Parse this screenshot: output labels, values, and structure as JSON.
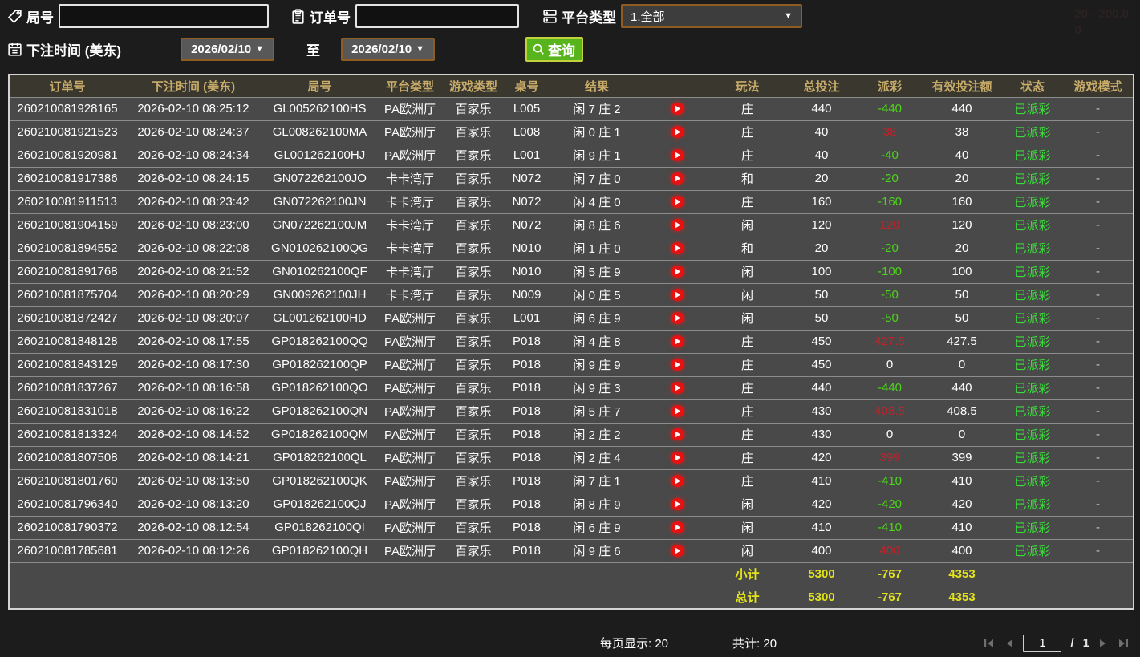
{
  "colors": {
    "header_text": "#c9ac6a",
    "row_bg": "#494949",
    "payout_negative": "#4cd41a",
    "payout_positive": "#bd242c",
    "status_green": "#3bdc3b",
    "totals_yellow": "#e3e31c",
    "search_button_green": "#58b41c",
    "date_border_brown": "#8f5c21",
    "play_button_red": "#e61212"
  },
  "filters": {
    "round_label": "局号",
    "round_value": "",
    "order_label": "订单号",
    "order_value": "",
    "platform_label": "平台类型",
    "platform_value": "1.全部",
    "bet_time_label": "下注时间 (美东)",
    "date_from": "2026/02/10",
    "to_label": "至",
    "date_to": "2026/02/10",
    "search_label": "查询"
  },
  "ghost": {
    "line1": "20 - 200.0",
    "line2": "0"
  },
  "table": {
    "columns": [
      "订单号",
      "下注时间 (美东)",
      "局号",
      "平台类型",
      "游戏类型",
      "桌号",
      "结果",
      "",
      "玩法",
      "总投注",
      "派彩",
      "有效投注额",
      "状态",
      "游戏模式"
    ],
    "rows": [
      {
        "order": "260210081928165",
        "time": "2026-02-10 08:25:12",
        "round": "GL005262100HS",
        "platform": "PA欧洲厅",
        "game": "百家乐",
        "table_no": "L005",
        "result": "闲 7 庄 2",
        "playtype": "庄",
        "bet": "440",
        "payout": "-440",
        "payout_class": "pay-neg",
        "valid": "440",
        "status": "已派彩",
        "mode": "-"
      },
      {
        "order": "260210081921523",
        "time": "2026-02-10 08:24:37",
        "round": "GL008262100MA",
        "platform": "PA欧洲厅",
        "game": "百家乐",
        "table_no": "L008",
        "result": "闲 0 庄 1",
        "playtype": "庄",
        "bet": "40",
        "payout": "38",
        "payout_class": "pay-pos",
        "valid": "38",
        "status": "已派彩",
        "mode": "-"
      },
      {
        "order": "260210081920981",
        "time": "2026-02-10 08:24:34",
        "round": "GL001262100HJ",
        "platform": "PA欧洲厅",
        "game": "百家乐",
        "table_no": "L001",
        "result": "闲 9 庄 1",
        "playtype": "庄",
        "bet": "40",
        "payout": "-40",
        "payout_class": "pay-neg",
        "valid": "40",
        "status": "已派彩",
        "mode": "-"
      },
      {
        "order": "260210081917386",
        "time": "2026-02-10 08:24:15",
        "round": "GN072262100JO",
        "platform": "卡卡湾厅",
        "game": "百家乐",
        "table_no": "N072",
        "result": "闲 7 庄 0",
        "playtype": "和",
        "bet": "20",
        "payout": "-20",
        "payout_class": "pay-neg",
        "valid": "20",
        "status": "已派彩",
        "mode": "-"
      },
      {
        "order": "260210081911513",
        "time": "2026-02-10 08:23:42",
        "round": "GN072262100JN",
        "platform": "卡卡湾厅",
        "game": "百家乐",
        "table_no": "N072",
        "result": "闲 4 庄 0",
        "playtype": "庄",
        "bet": "160",
        "payout": "-160",
        "payout_class": "pay-neg",
        "valid": "160",
        "status": "已派彩",
        "mode": "-"
      },
      {
        "order": "260210081904159",
        "time": "2026-02-10 08:23:00",
        "round": "GN072262100JM",
        "platform": "卡卡湾厅",
        "game": "百家乐",
        "table_no": "N072",
        "result": "闲 8 庄 6",
        "playtype": "闲",
        "bet": "120",
        "payout": "120",
        "payout_class": "pay-pos",
        "valid": "120",
        "status": "已派彩",
        "mode": "-"
      },
      {
        "order": "260210081894552",
        "time": "2026-02-10 08:22:08",
        "round": "GN010262100QG",
        "platform": "卡卡湾厅",
        "game": "百家乐",
        "table_no": "N010",
        "result": "闲 1 庄 0",
        "playtype": "和",
        "bet": "20",
        "payout": "-20",
        "payout_class": "pay-neg",
        "valid": "20",
        "status": "已派彩",
        "mode": "-"
      },
      {
        "order": "260210081891768",
        "time": "2026-02-10 08:21:52",
        "round": "GN010262100QF",
        "platform": "卡卡湾厅",
        "game": "百家乐",
        "table_no": "N010",
        "result": "闲 5 庄 9",
        "playtype": "闲",
        "bet": "100",
        "payout": "-100",
        "payout_class": "pay-neg",
        "valid": "100",
        "status": "已派彩",
        "mode": "-"
      },
      {
        "order": "260210081875704",
        "time": "2026-02-10 08:20:29",
        "round": "GN009262100JH",
        "platform": "卡卡湾厅",
        "game": "百家乐",
        "table_no": "N009",
        "result": "闲 0 庄 5",
        "playtype": "闲",
        "bet": "50",
        "payout": "-50",
        "payout_class": "pay-neg",
        "valid": "50",
        "status": "已派彩",
        "mode": "-"
      },
      {
        "order": "260210081872427",
        "time": "2026-02-10 08:20:07",
        "round": "GL001262100HD",
        "platform": "PA欧洲厅",
        "game": "百家乐",
        "table_no": "L001",
        "result": "闲 6 庄 9",
        "playtype": "闲",
        "bet": "50",
        "payout": "-50",
        "payout_class": "pay-neg",
        "valid": "50",
        "status": "已派彩",
        "mode": "-"
      },
      {
        "order": "260210081848128",
        "time": "2026-02-10 08:17:55",
        "round": "GP018262100QQ",
        "platform": "PA欧洲厅",
        "game": "百家乐",
        "table_no": "P018",
        "result": "闲 4 庄 8",
        "playtype": "庄",
        "bet": "450",
        "payout": "427.5",
        "payout_class": "pay-pos",
        "valid": "427.5",
        "status": "已派彩",
        "mode": "-"
      },
      {
        "order": "260210081843129",
        "time": "2026-02-10 08:17:30",
        "round": "GP018262100QP",
        "platform": "PA欧洲厅",
        "game": "百家乐",
        "table_no": "P018",
        "result": "闲 9 庄 9",
        "playtype": "庄",
        "bet": "450",
        "payout": "0",
        "payout_class": "pay-zero",
        "valid": "0",
        "status": "已派彩",
        "mode": "-"
      },
      {
        "order": "260210081837267",
        "time": "2026-02-10 08:16:58",
        "round": "GP018262100QO",
        "platform": "PA欧洲厅",
        "game": "百家乐",
        "table_no": "P018",
        "result": "闲 9 庄 3",
        "playtype": "庄",
        "bet": "440",
        "payout": "-440",
        "payout_class": "pay-neg",
        "valid": "440",
        "status": "已派彩",
        "mode": "-"
      },
      {
        "order": "260210081831018",
        "time": "2026-02-10 08:16:22",
        "round": "GP018262100QN",
        "platform": "PA欧洲厅",
        "game": "百家乐",
        "table_no": "P018",
        "result": "闲 5 庄 7",
        "playtype": "庄",
        "bet": "430",
        "payout": "408.5",
        "payout_class": "pay-pos",
        "valid": "408.5",
        "status": "已派彩",
        "mode": "-"
      },
      {
        "order": "260210081813324",
        "time": "2026-02-10 08:14:52",
        "round": "GP018262100QM",
        "platform": "PA欧洲厅",
        "game": "百家乐",
        "table_no": "P018",
        "result": "闲 2 庄 2",
        "playtype": "庄",
        "bet": "430",
        "payout": "0",
        "payout_class": "pay-zero",
        "valid": "0",
        "status": "已派彩",
        "mode": "-"
      },
      {
        "order": "260210081807508",
        "time": "2026-02-10 08:14:21",
        "round": "GP018262100QL",
        "platform": "PA欧洲厅",
        "game": "百家乐",
        "table_no": "P018",
        "result": "闲 2 庄 4",
        "playtype": "庄",
        "bet": "420",
        "payout": "399",
        "payout_class": "pay-pos",
        "valid": "399",
        "status": "已派彩",
        "mode": "-"
      },
      {
        "order": "260210081801760",
        "time": "2026-02-10 08:13:50",
        "round": "GP018262100QK",
        "platform": "PA欧洲厅",
        "game": "百家乐",
        "table_no": "P018",
        "result": "闲 7 庄 1",
        "playtype": "庄",
        "bet": "410",
        "payout": "-410",
        "payout_class": "pay-neg",
        "valid": "410",
        "status": "已派彩",
        "mode": "-"
      },
      {
        "order": "260210081796340",
        "time": "2026-02-10 08:13:20",
        "round": "GP018262100QJ",
        "platform": "PA欧洲厅",
        "game": "百家乐",
        "table_no": "P018",
        "result": "闲 8 庄 9",
        "playtype": "闲",
        "bet": "420",
        "payout": "-420",
        "payout_class": "pay-neg",
        "valid": "420",
        "status": "已派彩",
        "mode": "-"
      },
      {
        "order": "260210081790372",
        "time": "2026-02-10 08:12:54",
        "round": "GP018262100QI",
        "platform": "PA欧洲厅",
        "game": "百家乐",
        "table_no": "P018",
        "result": "闲 6 庄 9",
        "playtype": "闲",
        "bet": "410",
        "payout": "-410",
        "payout_class": "pay-neg",
        "valid": "410",
        "status": "已派彩",
        "mode": "-"
      },
      {
        "order": "260210081785681",
        "time": "2026-02-10 08:12:26",
        "round": "GP018262100QH",
        "platform": "PA欧洲厅",
        "game": "百家乐",
        "table_no": "P018",
        "result": "闲 9 庄 6",
        "playtype": "闲",
        "bet": "400",
        "payout": "400",
        "payout_class": "pay-pos",
        "valid": "400",
        "status": "已派彩",
        "mode": "-"
      }
    ]
  },
  "totals": {
    "subtotal_label": "小计",
    "total_label": "总计",
    "subtotal_bet": "5300",
    "subtotal_payout": "-767",
    "subtotal_valid": "4353",
    "total_bet": "5300",
    "total_payout": "-767",
    "total_valid": "4353"
  },
  "footer": {
    "per_page_label": "每页显示: 20",
    "total_count_label": "共计: 20",
    "page": "1",
    "page_sep": "/",
    "total_pages": "1"
  }
}
